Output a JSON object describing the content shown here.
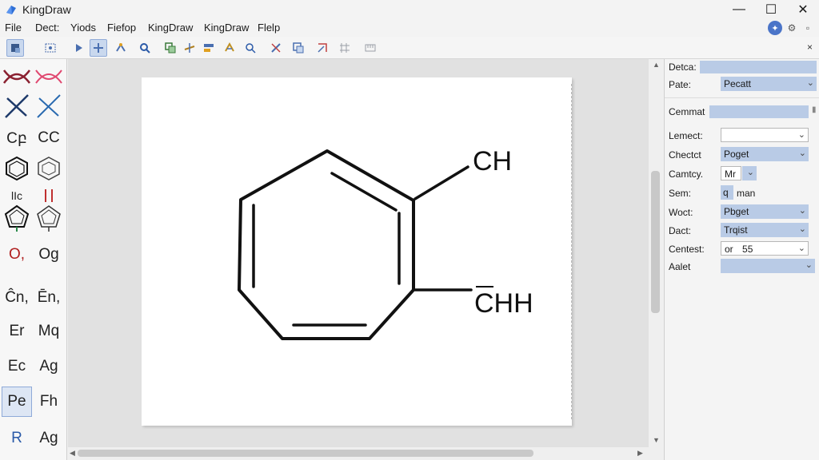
{
  "app": {
    "title": "KingDraw",
    "window_controls": [
      "—",
      "☐",
      "✕"
    ]
  },
  "menu": [
    "File",
    "Dect:",
    "Yiods",
    "Fiefop",
    "KingDraw",
    "KingDraw",
    "Flelp"
  ],
  "toolbar": {
    "close_label": "×"
  },
  "tools": [
    [
      "",
      ""
    ],
    [
      "",
      ""
    ],
    [
      "Cբ",
      "CC"
    ],
    [
      "",
      ""
    ],
    [
      "lIc",
      ""
    ],
    [
      "",
      ""
    ],
    [
      "O,",
      "Og"
    ],
    [
      "Ĉn,",
      "Ēn,"
    ],
    [
      "Er",
      "Mq"
    ],
    [
      "Ec",
      "Ag"
    ],
    [
      "Pe",
      "Fh"
    ],
    [
      "R",
      "Ag"
    ]
  ],
  "canvas": {
    "labels": {
      "top": "CH",
      "bottom": "CHH"
    }
  },
  "properties": {
    "header1": "Detca:",
    "row_pate": {
      "label": "Pate:",
      "value": "Pecatt"
    },
    "header2": "Cemmat",
    "rows": [
      {
        "label": "Lemect:",
        "value": ""
      },
      {
        "label": "Chectct",
        "value": "Poget"
      },
      {
        "label": "Camtcy.",
        "value": "Mr"
      },
      {
        "label": "Sem:",
        "value_a": "q",
        "value_b": "man"
      },
      {
        "label": "Woct:",
        "value": "Pbget"
      },
      {
        "label": "Dact:",
        "value": "Trqist"
      },
      {
        "label": "Centest:",
        "value_a": "or",
        "value_b": "55"
      },
      {
        "label": "Aalet",
        "value": ""
      }
    ]
  }
}
